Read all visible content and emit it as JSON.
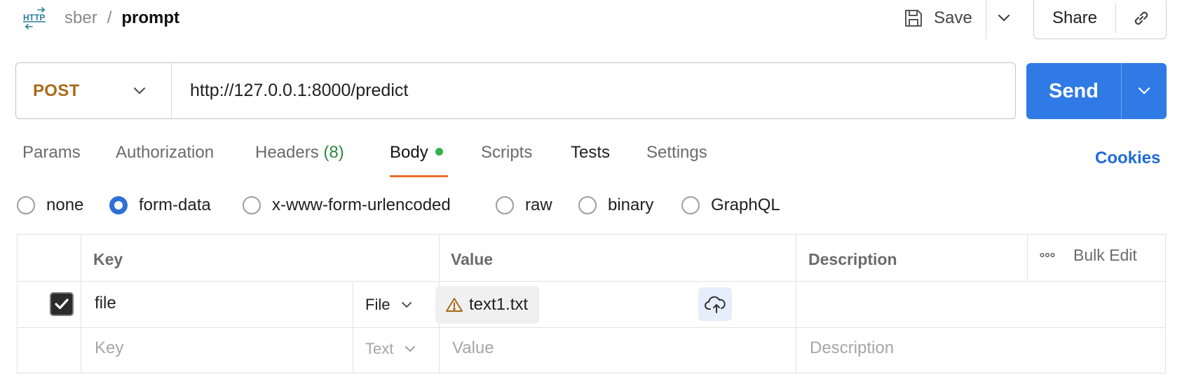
{
  "header": {
    "icon": "http-icon",
    "workspace": "sber",
    "separator": "/",
    "request_name": "prompt",
    "save_label": "Save",
    "share_label": "Share"
  },
  "request": {
    "method": "POST",
    "url": "http://127.0.0.1:8000/predict",
    "send_label": "Send"
  },
  "tabs": {
    "params": "Params",
    "authorization": "Authorization",
    "headers": "Headers",
    "headers_count": "(8)",
    "body": "Body",
    "scripts": "Scripts",
    "tests": "Tests",
    "settings": "Settings",
    "active": "Body",
    "cookies": "Cookies"
  },
  "body_types": {
    "none": "none",
    "form_data": "form-data",
    "urlencoded": "x-www-form-urlencoded",
    "raw": "raw",
    "binary": "binary",
    "graphql": "GraphQL",
    "selected": "form-data"
  },
  "table": {
    "headers": {
      "key": "Key",
      "value": "Value",
      "description": "Description",
      "bulk_edit": "Bulk Edit"
    },
    "rows": [
      {
        "checked": true,
        "key": "file",
        "type": "File",
        "value": "text1.txt",
        "description": ""
      }
    ],
    "new_row": {
      "key_placeholder": "Key",
      "type": "Text",
      "value_placeholder": "Value",
      "description_placeholder": "Description"
    }
  },
  "colors": {
    "accent": "#2f7ae5",
    "method": "#a86c1a",
    "active_tab_underline": "#ee6d2b",
    "body_dot": "#2fb34a",
    "headers_count": "#2b8a3e",
    "cookies": "#1f6ad6"
  }
}
